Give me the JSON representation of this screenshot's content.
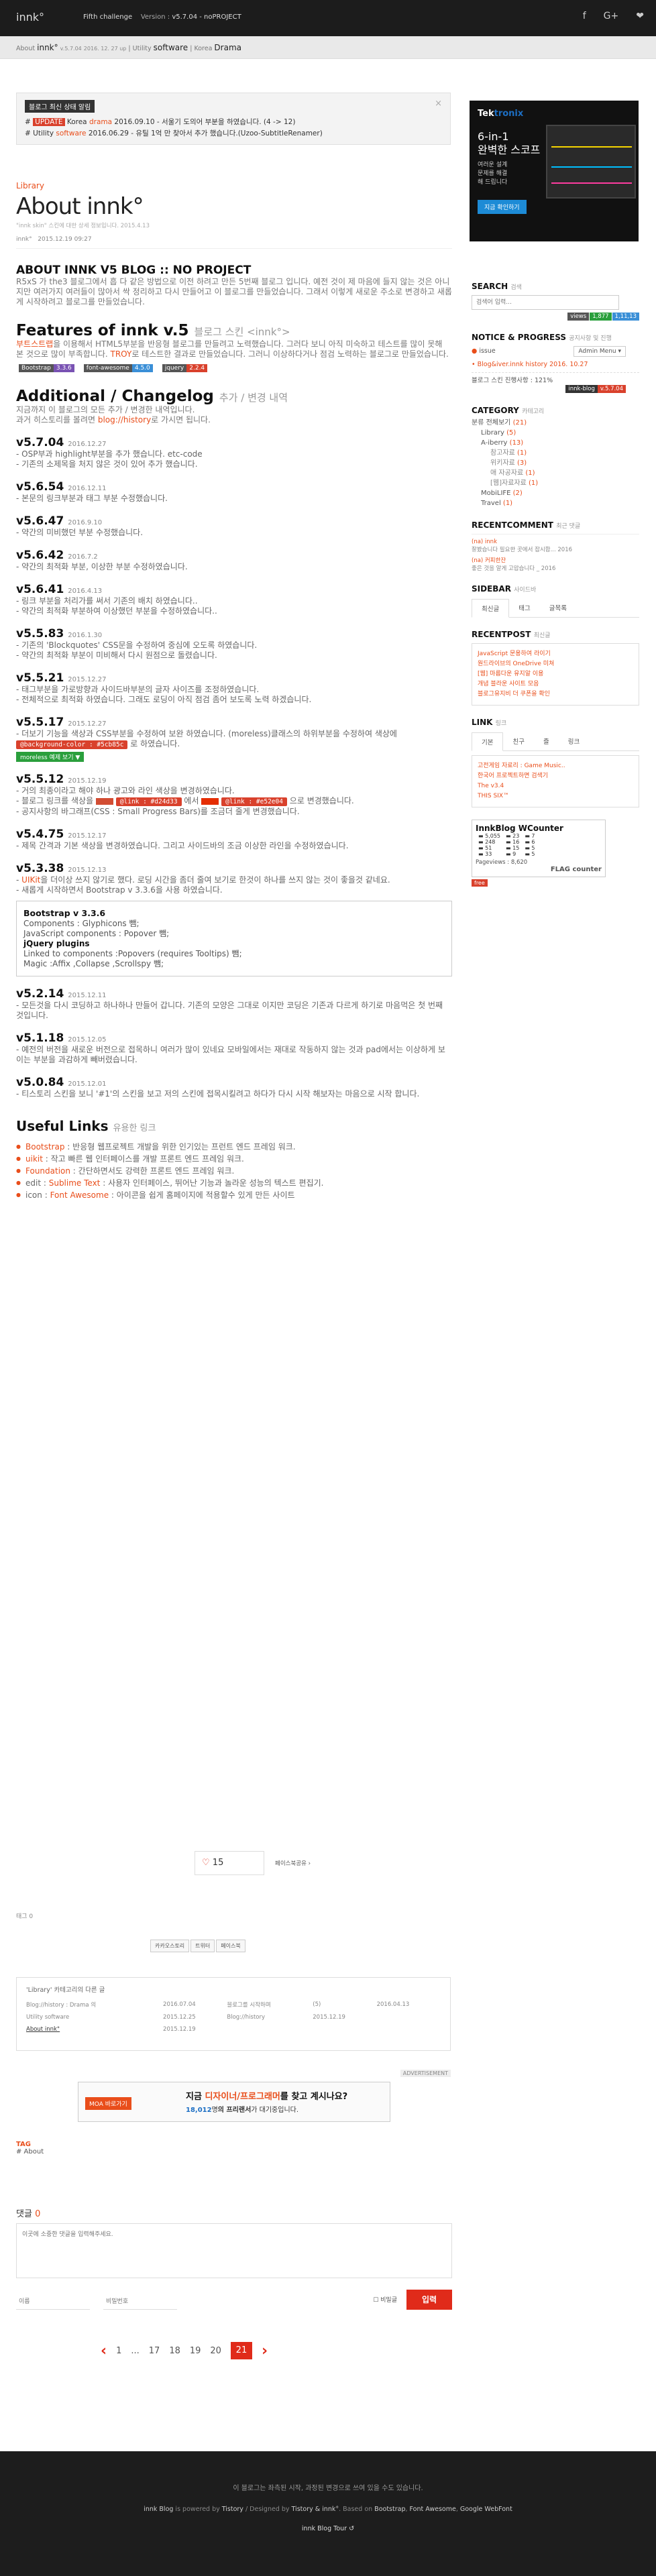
{
  "topbar": {
    "logo": "innk°",
    "event": "Fifth challenge",
    "version_label": "Version :",
    "version": "v5.7.04 - noPROJECT",
    "social": [
      "f",
      "G+",
      "❤"
    ]
  },
  "crumb": {
    "about": "About",
    "innk": "innk°",
    "ver": "v.5.7.04",
    "date": "2016. 12. 27 up",
    "sep1": "|",
    "utility": "Utility",
    "software": "software",
    "sep2": "|",
    "korea": "Korea",
    "drama": "Drama"
  },
  "notice": {
    "title": "블로그 최신 상태 알림",
    "line1": {
      "prefix": "#",
      "badge": "UPDATE",
      "text1": "Korea",
      "red": "drama",
      "text2": "2016.09.10 - 서울기 도의어 부분을 하였습니다. (4 -> 12)"
    },
    "line2": {
      "prefix": "#",
      "text1": "Utility",
      "red": "software",
      "text2": "2016.06.29 - 유틸 1억 만 찾아서 추가 했습니다.(Uzoo-SubtitleRenamer)"
    }
  },
  "ad1": {
    "brand1": "Tek",
    "brand2": "tronix",
    "title": "6-in-1\n완벽한 스코프",
    "sub": "여러운 설계\n문제를 해결\n해 드립니다",
    "btn": "지금 확인하기"
  },
  "post": {
    "category": "Library",
    "title": "About innk°",
    "meta": "\"innk skin\" 스킨에 대한 상세 정보입니다.  2015.4.13",
    "meta2_author": "innk°",
    "meta2_date": "2015.12.19 09:27",
    "heading": "ABOUT INNK V5 BLOG :: NO PROJECT",
    "intro": "R5xS 가 the3 블로그에서 흡 다 같은 방법으로 이전 하려고 만든 5번째 블로그 입니다. 예전 것이 제 마음에 들지 않는 것은 아니지만 여러가지 여러들이 많아서 싹 정리하고 다시 만들어고 이 블로그를 만들었습니다. 그래서 이렇게 새로운 주소로 변경하고 새롭게 시작하려고 블로그를 만들었습니다.",
    "features_title": "Features of innk v.5",
    "features_sub": "블로그 스킨 <innk°>",
    "features_text_a": "부트스트랩",
    "features_text_b": "을 이용해서 HTML5부분을 반응형 블로그를 만들려고 노력했습니다. 그러다 보니 아직 미숙하고 테스트를 많이 못해 본 것으로 많이 부족합니다. ",
    "features_text_c": "TROY",
    "features_text_d": "로 테스트한 결과로 만들었습니다. 그러니 이상하다거나 점검 노력하는 블로그로 만들었습니다.",
    "badges": [
      {
        "k": "Bootstrap",
        "v": "3.3.6",
        "c": "#7952b3"
      },
      {
        "k": "font-awesome",
        "v": "4.5.0",
        "c": "#3a8fd7"
      },
      {
        "k": "jquery",
        "v": "2.2.4",
        "c": "#d9412c"
      }
    ],
    "changelog_title": "Additional / Changelog",
    "changelog_sub": "추가 / 변경 내역",
    "changelog_intro1": "지금까지 이 블로그의 모든 추가 / 변경한 내역입니다.",
    "changelog_intro2_a": "과거 히스토리를 볼려면",
    "changelog_intro2_b": "blog://history",
    "changelog_intro2_c": "로 가시면 됩니다."
  },
  "versions": [
    {
      "v": "v5.7.04",
      "d": "2016.12.27",
      "lines": [
        "- OSP부과 highlight부분을 추가 했습니다. etc-code",
        "- 기존의 소제목을 처지 않은 것이 있어 추가 했습니다."
      ]
    },
    {
      "v": "v5.6.54",
      "d": "2016.12.11",
      "lines": [
        "- 본문의 링크부분과 태그 부분 수정했습니다."
      ]
    },
    {
      "v": "v5.6.47",
      "d": "2016.9.10",
      "lines": [
        "- 약간의 미비했던 부분 수정했습니다."
      ]
    },
    {
      "v": "v5.6.42",
      "d": "2016.7.2",
      "lines": [
        "- 약간의 최적화 부분, 이상한 부분 수정하였습니다."
      ]
    },
    {
      "v": "v5.6.41",
      "d": "2016.4.13",
      "lines": [
        "- 링크 부분을 처리가를 써서 기존의 배치 하였습니다..",
        "- 약간의 최적화 부분하여 이상했던 부분을 수정하였습니다.."
      ]
    },
    {
      "v": "v5.5.83",
      "d": "2016.1.30",
      "lines": [
        "- 기존의 'Blockquotes' CSS문을 수정하여 중심에 오도록 하였습니다.",
        "- 약간의 최적화 부분이 미비해서 다시 원점으로 돌렸습니다."
      ]
    },
    {
      "v": "v5.5.21",
      "d": "2015.12.27",
      "lines": [
        "- 태그부분을 가로방향과 사이드바부분의 글자 사이즈를 조정하였습니다.",
        "- 전체적으로 최적화 하였습니다. 그래도 로딩이 아직 점검 좀어 보도록 노력 하겠습니다."
      ]
    },
    {
      "v": "v5.5.17",
      "d": "2015.12.27",
      "lines": [
        "- 더보기 기능을 색상과 CSS부분을 수정하여 보완 하였습니다. (moreless)클래스의 하위부분을 수정하여 색상에"
      ],
      "code": "@background-color : #5cb85c",
      "code2": "로 하였습니다.",
      "chip": "moreless 예제 보기 ▼"
    },
    {
      "v": "v5.5.12",
      "d": "2015.12.19",
      "lines": [
        "- 거의 최종이라고 해야 하나 광고와 라인 색상을 변경하였습니다."
      ],
      "l2a": "- 블로그 링크를 색상을",
      "c1": "@link : #d24d33",
      "l2b": "에서",
      "c2": "@link : #e52e04",
      "l2c": "으로 변경했습니다.",
      "l3": "- 공지사항의 바그래프(CSS : Small Progress Bars)를 조금더 줄게 변경했습니다."
    },
    {
      "v": "v5.4.75",
      "d": "2015.12.17",
      "lines": [
        "- 제목 간격과 기본 색상을 변경하였습니다. 그리고 사이드바의 조금 이상한 라인을 수정하였습니다."
      ]
    },
    {
      "v": "v5.3.38",
      "d": "2015.12.13",
      "lines": [],
      "l1a": "- ",
      "l1b": "UIKit",
      "l1c": "을 더이상 쓰지 않기로 했다. 로딩 시간을 좀더 줄여 보기로 한것이 하나를 쓰지 않는 것이 좋을것 같네요.",
      "l2": "- 새롭게 시작하면서 Bootstrap v 3.3.6을 사용 하였습니다."
    }
  ],
  "bsbox": {
    "title": "Bootstrap v 3.3.6",
    "lines": [
      "Components : Glyphicons 뺌;",
      "JavaScript components : Popover 뺌;"
    ],
    "jq": "jQuery plugins",
    "lines2": [
      "Linked to components :Popovers (requires Tooltips) 뺌;",
      "Magic :Affix ,Collapse ,Scrollspy 뺌;"
    ]
  },
  "versions2": [
    {
      "v": "v5.2.14",
      "d": "2015.12.11",
      "lines": [
        "- 모든것을 다시 코딩하고 하나하나 만들어 갑니다. 기존의 모양은 그대로 이지만 코딩은 기존과 다르게 하기로 마음먹은 첫 번째 것입니다."
      ]
    },
    {
      "v": "v5.1.18",
      "d": "2015.12.05",
      "lines": [
        "- 예전의 버전을 새로운 버전으로 접목하니 여러가 많이 있네요 모바일에서는 재대로 작동하지 않는 것과 pad에서는 이상하게 보이는 부분을 과감하게 빼버렸습니다."
      ]
    },
    {
      "v": "v5.0.84",
      "d": "2015.12.01",
      "lines": [
        "- 티스토리 스킨을 보니 '#1'의 스킨을 보고 저의 스킨에 접목시킬려고 하다가 다시 시작 해보자는 마음으로 시작 합니다."
      ]
    }
  ],
  "links_title": "Useful Links",
  "links_sub": "유용한 링크",
  "links": [
    {
      "name": "Bootstrap",
      "text": " : 반응형 웹프로젝트 개발을 위한 인기있는 프런트 엔드 프레임 워크."
    },
    {
      "name": "uikit",
      "text": " : 작고 빠른 웹 인터페이스를 개발 프론트 엔드 프레임 워크."
    },
    {
      "name": "Foundation",
      "text": " : 간단하면서도 강력한 프론트 엔드 프레임 워크."
    },
    {
      "name": "Sublime Text",
      "prefix": "edit : ",
      "text": " : 사용자 인터페이스, 뛰어난 기능과 놀라운 성능의 텍스트 편집기."
    },
    {
      "name": "Font Awesome",
      "prefix": "icon : ",
      "text": " : 아이콘을 쉽게 홈페이지에 적용할수 있게 만든 사이트"
    }
  ],
  "like": {
    "count": "15",
    "share": "페이스북공유 ›"
  },
  "tag_label": "태그 0",
  "share_btns": [
    "카카오스토리",
    "트위터",
    "페이스북"
  ],
  "related": {
    "title": "'Library' 카테고리의 다른 글",
    "rows": [
      [
        "Blog://history : Drama 의",
        "2016.07.04",
        "블로그를 시작하며",
        "(5)",
        "2016.04.13"
      ],
      [
        "Utility software",
        "2015.12.25",
        "Blog://history",
        "2015.12.19",
        ""
      ],
      [
        "About innk°",
        "2015.12.19",
        "",
        "",
        ""
      ]
    ]
  },
  "advert_label": "ADVERTISEMENT",
  "ad2": {
    "logo": "MOA 바로가기",
    "t1": "지금",
    "t2": "디자이너/프로그래머",
    "t3": "를 찾고 계시나요?",
    "t4": "18,012",
    "t5": "명",
    "t6": "의 프리랜서",
    "t7": "가 대기중입니다."
  },
  "tagbox": {
    "label": "TAG",
    "value": "# About"
  },
  "comment": {
    "title": "댓글",
    "count": "0",
    "placeholder": "이곳에 소중한 댓글을 입력해주세요.",
    "name_ph": "이름",
    "pw_ph": "비밀번호",
    "secret": "비밀글",
    "submit": "입력"
  },
  "pager": {
    "prev": "‹",
    "items": [
      "1",
      "...",
      "17",
      "18",
      "19",
      "20",
      "21"
    ],
    "next": "›"
  },
  "footer": {
    "f1": "이 블로그는 좌측된 시작, 과정된 변경으로 쓰여 있을 수도 있습니다.",
    "f2a": "innk Blog",
    "f2b": " is powered by ",
    "f2c": "Tistory",
    "f2d": " / Designed by ",
    "f2e": "Tistory & innk°",
    "f2f": ". Based on ",
    "f2g": "Bootstrap",
    "f2h": ", ",
    "f2i": "Font Awesome",
    "f2j": ", ",
    "f2k": "Google WebFont",
    "f3": "innk Blog Tour ↺"
  },
  "side": {
    "search_title": "SEARCH",
    "search_sub": "검색",
    "search_ph": "검색어 입력...",
    "views_label": "views",
    "views1": "1,877",
    "views2": "1,11,13",
    "notice_title": "NOTICE & PROGRESS",
    "notice_sub": "공지사항 및 진행",
    "notice_issue": "issue",
    "admin_menu": "Admin Menu ▾",
    "notice_link": "Blog&iver.innk history 2016. 10.27",
    "progress_text": "블로그 스킨 진행사항 : 121%",
    "progress_badge_k": "innk-blog",
    "progress_badge_v": "v.5.7.04",
    "cat_title": "CATEGORY",
    "cat_sub": "카테고리",
    "categories": [
      {
        "n": "분류 전체보기",
        "c": "(21)",
        "lv": 0
      },
      {
        "n": "Library",
        "c": "(5)",
        "lv": 1
      },
      {
        "n": "A-iberry",
        "c": "(13)",
        "lv": 1
      },
      {
        "n": "참고자료",
        "c": "(1)",
        "lv": 2
      },
      {
        "n": "위키자료",
        "c": "(3)",
        "lv": 2
      },
      {
        "n": "애 자공자료",
        "c": "(1)",
        "lv": 2
      },
      {
        "n": "[웹]자료자료",
        "c": "(1)",
        "lv": 2
      },
      {
        "n": "MobiLIFE",
        "c": "(2)",
        "lv": 1
      },
      {
        "n": "Travel",
        "c": "(1)",
        "lv": 1
      }
    ],
    "rc_title": "RECENTCOMMENT",
    "rc_sub": "최근 댓글",
    "rc": [
      {
        "a": "(na) innk",
        "t": "잘봤습니다 필요한 곳에서 잡시합... 2016"
      },
      {
        "a": "(na) 커피한잔",
        "t": "좋은 것을 알게 고맙습니다 _ 2016"
      }
    ],
    "sb_title": "SIDEBAR",
    "sb_sub": "사이드바",
    "tabs1": [
      "최신글",
      "태그",
      "글목록"
    ],
    "rp_title": "RECENTPOST",
    "rp_sub": "최신글",
    "rp": [
      "JavaScript 문용하여 라이기",
      "원드라이브의 OneDrive 미쳐",
      "[웹] 마름다운 유지알 이용",
      "개념 블라운 사이트 모음",
      "블로그유지비 더 쿠폰을 확인"
    ],
    "link_title": "LINK",
    "link_sub": "링크",
    "tabs2": [
      "기본",
      "친구",
      "즐",
      "링크"
    ],
    "links": [
      "고전게임 자료리 : Game Music..",
      "한국어 프로젝트하면 검색기",
      "The v3.4",
      "THIS SIX™"
    ],
    "wc_title": "InnkBlog WCounter",
    "wc": [
      [
        "5,055",
        "23",
        "7"
      ],
      [
        "248",
        "16",
        "6"
      ],
      [
        "51",
        "15",
        "5"
      ],
      [
        "33",
        "9",
        "5"
      ]
    ],
    "wc_pv": "Pageviews : 8,620",
    "flag": "FLAG counter",
    "flag2": "free"
  }
}
